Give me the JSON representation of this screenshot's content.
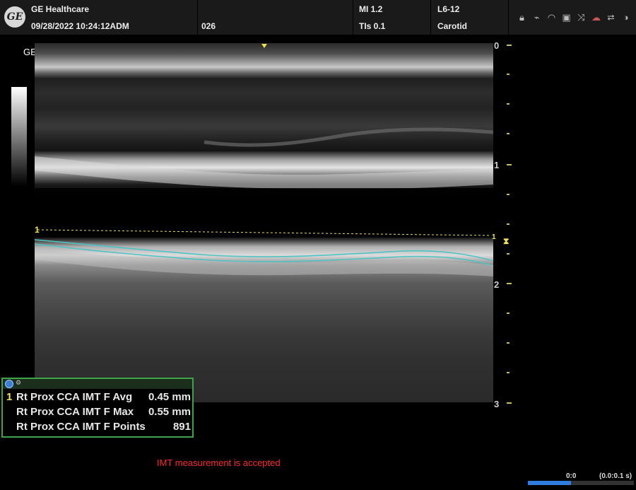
{
  "header": {
    "brand": "GE Healthcare",
    "datetime": "09/28/2022  10:24:12ADM",
    "patient_id": "026",
    "mi": "MI 1.2",
    "tis": "TIs 0.1",
    "probe": "L6-12",
    "preset": "Carotid",
    "status_icons": [
      "lock-icon",
      "usb-icon",
      "wifi-icon",
      "network-icon",
      "usb-drive-icon",
      "cloud-icon",
      "power-icon",
      "contrast-icon"
    ]
  },
  "image": {
    "vendor_label": "GE",
    "depth_scale": [
      "0",
      "1",
      "2",
      "3"
    ],
    "measurement_marker": "1"
  },
  "results": {
    "rows": [
      {
        "num": "1",
        "label": "Rt Prox  CCA IMT F Avg",
        "value": "0.45 mm"
      },
      {
        "num": "",
        "label": "Rt Prox  CCA IMT F Max",
        "value": "0.55 mm"
      },
      {
        "num": "",
        "label": "Rt Prox  CCA IMT F Points",
        "value": "891"
      }
    ]
  },
  "status": {
    "message": "IMT measurement is accepted"
  },
  "cine": {
    "frame": "0:0",
    "range": "(0.0:0.1 s)"
  },
  "colors": {
    "accent_green": "#3ea34b",
    "trace_cyan": "#4fc3c3",
    "marker_yellow": "#f2e35a",
    "message_red": "#ff2a2a"
  }
}
